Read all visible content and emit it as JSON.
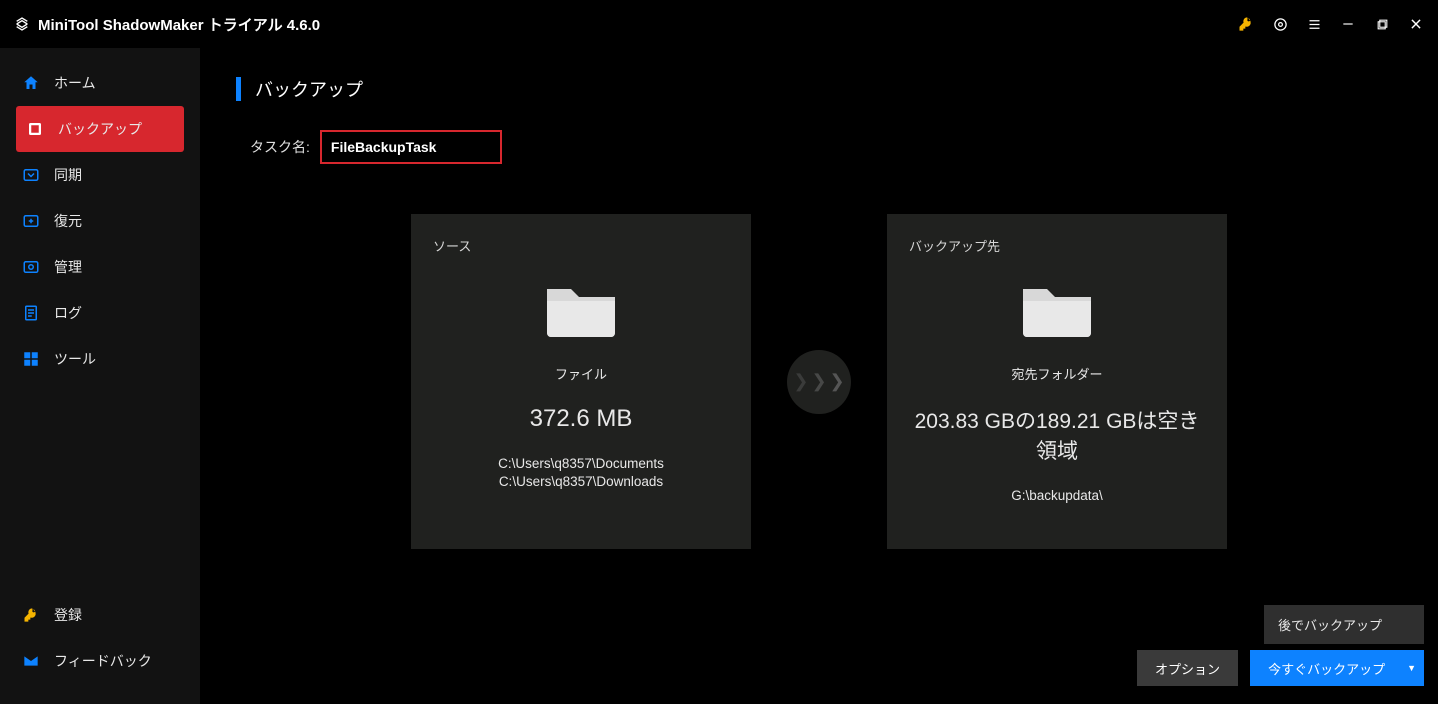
{
  "titlebar": {
    "app_name": "MiniTool ShadowMaker トライアル 4.6.0"
  },
  "sidebar": {
    "items": [
      {
        "label": "ホーム",
        "icon": "home"
      },
      {
        "label": "バックアップ",
        "icon": "backup"
      },
      {
        "label": "同期",
        "icon": "sync"
      },
      {
        "label": "復元",
        "icon": "restore"
      },
      {
        "label": "管理",
        "icon": "manage"
      },
      {
        "label": "ログ",
        "icon": "log"
      },
      {
        "label": "ツール",
        "icon": "tools"
      }
    ],
    "bottom_items": [
      {
        "label": "登録",
        "icon": "key"
      },
      {
        "label": "フィードバック",
        "icon": "mail"
      }
    ]
  },
  "page": {
    "title": "バックアップ",
    "taskname_label": "タスク名:",
    "taskname_value": "FileBackupTask"
  },
  "source_card": {
    "heading": "ソース",
    "sub": "ファイル",
    "size": "372.6 MB",
    "paths": [
      "C:\\Users\\q8357\\Documents",
      "C:\\Users\\q8357\\Downloads"
    ]
  },
  "dest_card": {
    "heading": "バックアップ先",
    "sub": "宛先フォルダー",
    "capacity_line": "203.83 GBの189.21 GBは空き領域",
    "path": "G:\\backupdata\\"
  },
  "actions": {
    "dropdown_item": "後でバックアップ",
    "options_label": "オプション",
    "backup_now_label": "今すぐバックアップ"
  }
}
